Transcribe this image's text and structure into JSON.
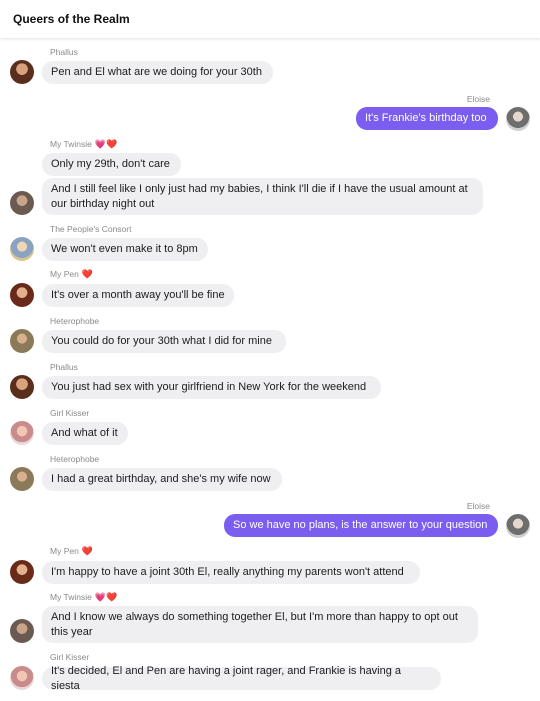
{
  "header": {
    "title": "Queers of the Realm"
  },
  "messages": [
    {
      "sender": "Phallus",
      "text": "Pen and El what are we doing for your 30th"
    },
    {
      "sender": "Eloise",
      "text": "It's Frankie's birthday too"
    },
    {
      "sender": "My Twinsie",
      "text": "Only my 29th, don't care"
    },
    {
      "text": "And I still feel like I only just had my babies, I think I'll die if I have the usual amount at our birthday night out"
    },
    {
      "sender": "The People's Consort",
      "text": "We won't even make it to 8pm"
    },
    {
      "sender": "My Pen",
      "text": "It's over a month away you'll be fine"
    },
    {
      "sender": "Heterophobe",
      "text": "You could do for your 30th what I did for mine"
    },
    {
      "sender": "Phallus",
      "text": "You just had sex with your girlfriend in New York for the weekend"
    },
    {
      "sender": "Girl Kisser",
      "text": "And what of it"
    },
    {
      "sender": "Heterophobe",
      "text": "I had a great birthday, and she's my wife now"
    },
    {
      "sender": "Eloise",
      "text": "So we have no plans, is the answer to your question"
    },
    {
      "sender": "My Pen",
      "text": "I'm happy to have a joint 30th El, really anything my parents won't attend"
    },
    {
      "sender": "My Twinsie",
      "text": "And I know we always do something together El, but I'm more than happy to opt out this year"
    },
    {
      "sender": "Girl Kisser",
      "text": "It's decided, El and Pen are having a joint rager, and Frankie is having a siesta"
    }
  ],
  "hearts": {
    "pink": "💗",
    "red": "❤️"
  },
  "colors": {
    "outgoing_bubble": "#7b5ef0",
    "incoming_bubble": "#efeff2"
  },
  "icons": {
    "avatar": "avatar-photo-icon"
  }
}
